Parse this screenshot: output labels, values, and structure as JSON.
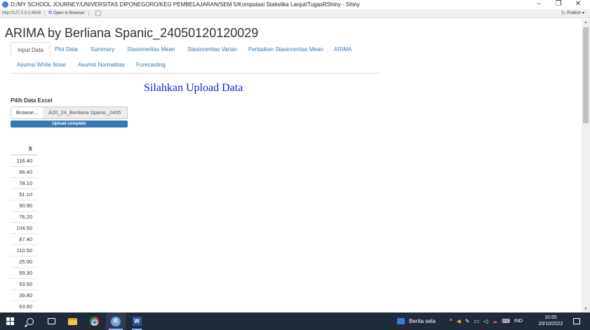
{
  "window": {
    "title": "D:/MY SCHOOL JOURNEY/UNIVERSITAS DIPONEGORO/KEG PEMBELAJARAN/SEM 5/Komputasi Statistika Lanjut/TugasRShiny - Shiny",
    "minimize": "–",
    "restore": "❐",
    "close": "✕"
  },
  "toolbar": {
    "url": "http://127.0.0.1:4808",
    "open_browser": "Open in Browser",
    "publish": "Publish"
  },
  "app": {
    "title": "ARIMA by Berliana Spanic_24050120120029",
    "tabs": [
      {
        "label": "Input Data",
        "active": true
      },
      {
        "label": "Plot Data"
      },
      {
        "label": "Summary"
      },
      {
        "label": "Stasioneritas Mean"
      },
      {
        "label": "Stasioneritas Varian"
      },
      {
        "label": "Perbaikan Stasioneritas Mean"
      },
      {
        "label": "ARIMA"
      },
      {
        "label": "Asumsi White Nose"
      },
      {
        "label": "Asumsi Normalitas"
      },
      {
        "label": "Forecasting"
      }
    ],
    "heading": "Silahkan Upload Data",
    "file_input": {
      "label": "Pilih Data Excel",
      "browse": "Browse...",
      "filename": "A20_24_Berliana Spanic_2405",
      "progress": "Upload complete",
      "progress_fraction": 1.0
    },
    "table": {
      "header": "X",
      "rows": [
        "116.40",
        "88.40",
        "78.10",
        "51.10",
        "90.90",
        "76.20",
        "104.50",
        "87.40",
        "110.50",
        "25.00",
        "69.30",
        "53.50",
        "39.80",
        "63.60"
      ]
    }
  },
  "taskbar": {
    "news": "Berita sela",
    "lang": "IND",
    "time": "10:55",
    "date": "20/10/2022",
    "r_label": "R",
    "word_label": "W"
  },
  "colors": {
    "link": "#337ab7",
    "heading": "#1a1ad6",
    "progress": "#337ab7",
    "taskbar": "#1f2a3a"
  }
}
